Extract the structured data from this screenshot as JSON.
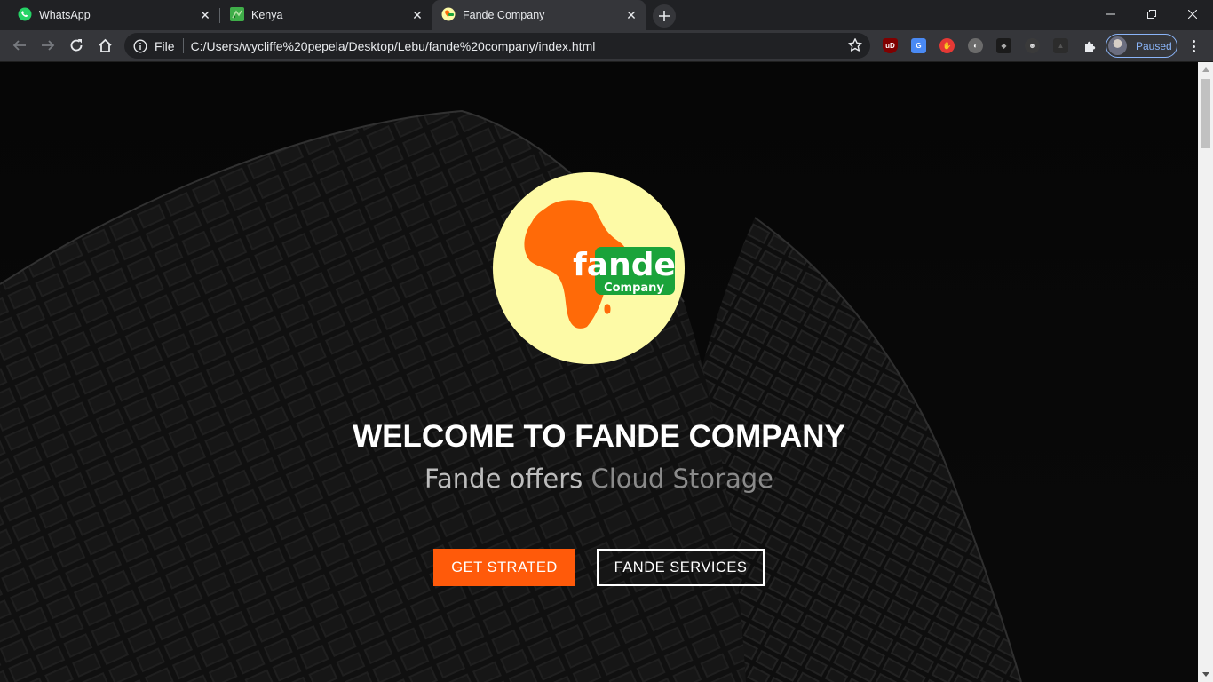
{
  "browser": {
    "tabs": [
      {
        "label": "WhatsApp",
        "icon": "whatsapp-icon",
        "active": false
      },
      {
        "label": "Kenya",
        "icon": "map-favicon",
        "active": false
      },
      {
        "label": "Fande Company",
        "icon": "fande-favicon",
        "active": true
      }
    ],
    "address": {
      "scheme_label": "File",
      "url": "C:/Users/wycliffe%20pepela/Desktop/Lebu/fande%20company/index.html"
    },
    "extensions": [
      "ublock-icon",
      "google-translate-icon",
      "stop-hand-icon",
      "extension-icon",
      "cube-icon",
      "robot-icon",
      "shield-icon",
      "puzzle-icon"
    ],
    "profile_status": "Paused",
    "colors": {
      "tabstrip": "#202124",
      "toolbar": "#35363a",
      "accent": "#8ab4f8"
    }
  },
  "page": {
    "logo": {
      "wordmark": "fande",
      "sub": "Company",
      "colors": {
        "disc": "#fdfaa6",
        "africa": "#ff6a08",
        "badge": "#1aa33a"
      }
    },
    "hero": {
      "title": "WELCOME TO FANDE COMPANY",
      "subtitle_lead": "Fande offers",
      "subtitle_accent": "Cloud Storage"
    },
    "buttons": {
      "primary": "GET STRATED",
      "secondary": "FANDE SERVICES"
    },
    "colors": {
      "primary_button": "#ff5a0a",
      "background": "#050505"
    }
  }
}
